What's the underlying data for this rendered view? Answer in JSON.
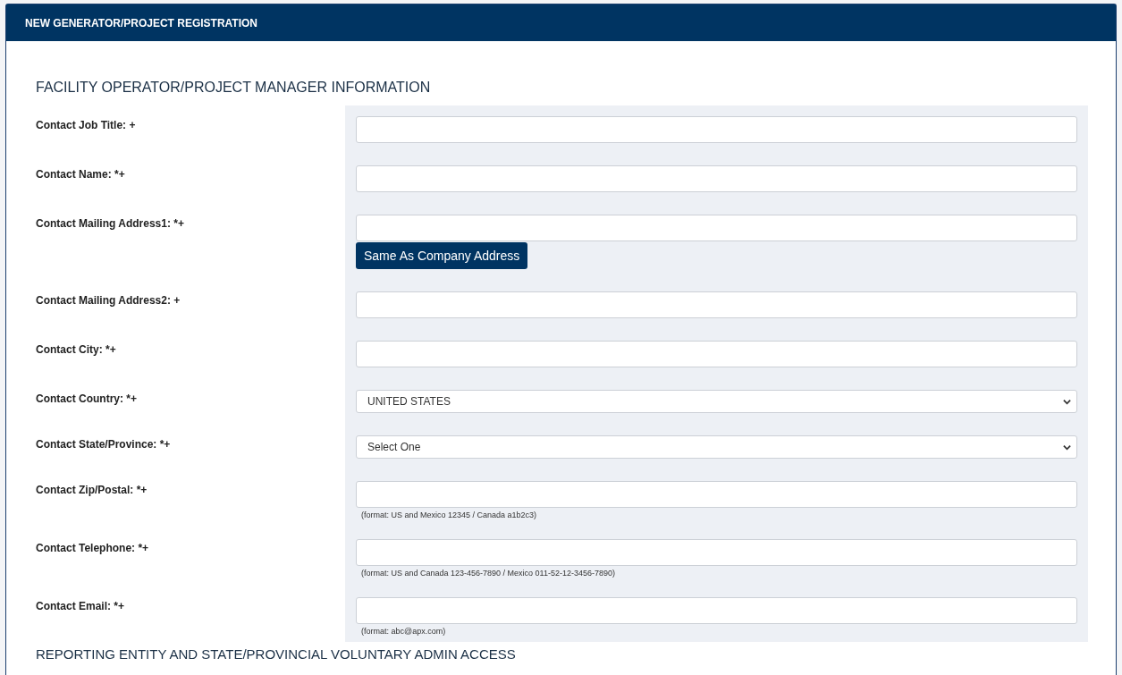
{
  "header": {
    "title": "NEW GENERATOR/PROJECT REGISTRATION"
  },
  "section": {
    "title": "FACILITY OPERATOR/PROJECT MANAGER INFORMATION"
  },
  "fields": [
    {
      "label": "Contact Job Title: +",
      "kind": "text"
    },
    {
      "label": "Contact Name: *+",
      "kind": "text"
    },
    {
      "label": "Contact Mailing Address1: *+",
      "kind": "text",
      "button": "Same As Company Address"
    },
    {
      "label": "Contact Mailing Address2: +",
      "kind": "text"
    },
    {
      "label": "Contact City: *+",
      "kind": "text"
    },
    {
      "label": "Contact Country: *+",
      "kind": "select",
      "value": "UNITED STATES"
    },
    {
      "label": "Contact State/Province: *+",
      "kind": "select",
      "value": "Select One"
    },
    {
      "label": "Contact Zip/Postal: *+",
      "kind": "text",
      "hint": "(format: US and Mexico 12345 / Canada a1b2c3)"
    },
    {
      "label": "Contact Telephone: *+",
      "kind": "text",
      "hint": "(format: US and Canada 123-456-7890 / Mexico 011-52-12-3456-7890)"
    },
    {
      "label": "Contact Email: *+",
      "kind": "text",
      "hint": "(format: abc@apx.com)"
    }
  ],
  "next_section": {
    "title": "REPORTING ENTITY AND STATE/PROVINCIAL VOLUNTARY ADMIN ACCESS"
  }
}
